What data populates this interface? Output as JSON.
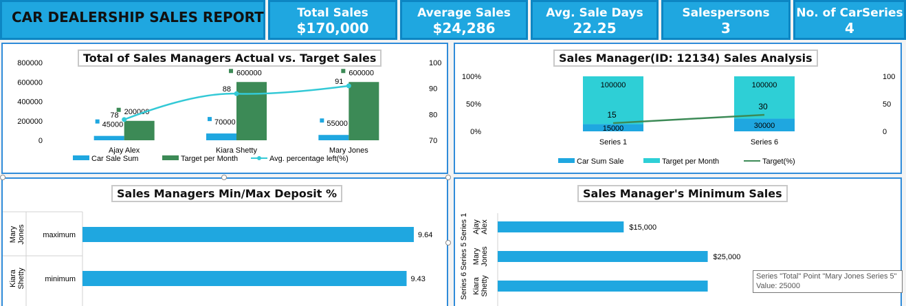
{
  "header": {
    "report_title": "CAR DEALERSHIP SALES REPORT",
    "kpis": [
      {
        "title": "Total Sales",
        "value": "$170,000"
      },
      {
        "title": "Average Sales",
        "value": "$24,286"
      },
      {
        "title": "Avg. Sale Days",
        "value": "22.25"
      },
      {
        "title": "Salespersons",
        "value": "3"
      },
      {
        "title": "No. of CarSeries",
        "value": "4"
      }
    ]
  },
  "colors": {
    "blue": "#1fa7e0",
    "green": "#3c8a56",
    "teal": "#2ecfd6",
    "line_teal": "#33c9d6",
    "line_green": "#3c8a56"
  },
  "chart_data": [
    {
      "type": "bar",
      "title": "Total of Sales Managers Actual vs. Target Sales",
      "categories": [
        "Ajay Alex",
        "Kiara Shetty",
        "Mary Jones"
      ],
      "series": [
        {
          "name": "Car Sale Sum",
          "values": [
            45000,
            70000,
            55000
          ],
          "labels": [
            "45000",
            "70000",
            "55000"
          ]
        },
        {
          "name": "Target per Month",
          "values": [
            200000,
            600000,
            600000
          ],
          "labels": [
            "200000",
            "600000",
            "600000"
          ]
        },
        {
          "name": "Avg. percentage left(%)",
          "values": [
            78,
            88,
            91
          ],
          "labels": [
            "78",
            "88",
            "91"
          ],
          "axis": "secondary",
          "kind": "line"
        }
      ],
      "y_ticks": [
        "800000",
        "600000",
        "400000",
        "200000",
        "0"
      ],
      "ylim": [
        0,
        800000
      ],
      "y2_ticks": [
        "100",
        "90",
        "80",
        "70"
      ],
      "y2lim": [
        70,
        100
      ],
      "legend": "bottom"
    },
    {
      "type": "bar",
      "title": "Sales Manager(ID: 12134) Sales Analysis",
      "categories": [
        "Series 1",
        "Series 6"
      ],
      "series": [
        {
          "name": "Car Sum Sale",
          "values": [
            15000,
            30000
          ],
          "labels": [
            "15000",
            "30000"
          ]
        },
        {
          "name": "Target per Month",
          "values": [
            100000,
            100000
          ],
          "labels": [
            "100000",
            "100000"
          ]
        },
        {
          "name": "Target(%)",
          "values": [
            15,
            30
          ],
          "labels": [
            "15",
            "30"
          ],
          "axis": "secondary",
          "kind": "line"
        }
      ],
      "stacked_percent": true,
      "y_ticks": [
        "100%",
        "50%",
        "0%"
      ],
      "y2_ticks": [
        "100",
        "50",
        "0"
      ],
      "y2lim": [
        0,
        100
      ],
      "legend": "bottom"
    },
    {
      "type": "bar",
      "orientation": "horizontal",
      "title": "Sales Managers Min/Max Deposit %",
      "groups": [
        {
          "name": "Mary Jones",
          "category": "maximum",
          "value": 9.64,
          "label": "9.64"
        },
        {
          "name": "Kiara Shetty",
          "category": "minimum",
          "value": 9.43,
          "label": "9.43"
        }
      ],
      "xlim": [
        0,
        10
      ]
    },
    {
      "type": "bar",
      "orientation": "horizontal",
      "title": "Sales Manager's Minimum Sales",
      "groups": [
        {
          "series": "Series 1",
          "name": "Ajay Alex",
          "value": 15000,
          "label": "$15,000"
        },
        {
          "series": "Series 5",
          "name": "Mary Jones",
          "value": 25000,
          "label": "$25,000"
        },
        {
          "series": "Series 6",
          "name": "Kiara Shetty",
          "value": 25000,
          "label": ""
        }
      ],
      "xlim": [
        0,
        45000
      ]
    }
  ],
  "tooltip": {
    "line1": "Series \"Total\" Point \"Mary Jones Series 5\"",
    "line2": "Value: 25000"
  }
}
